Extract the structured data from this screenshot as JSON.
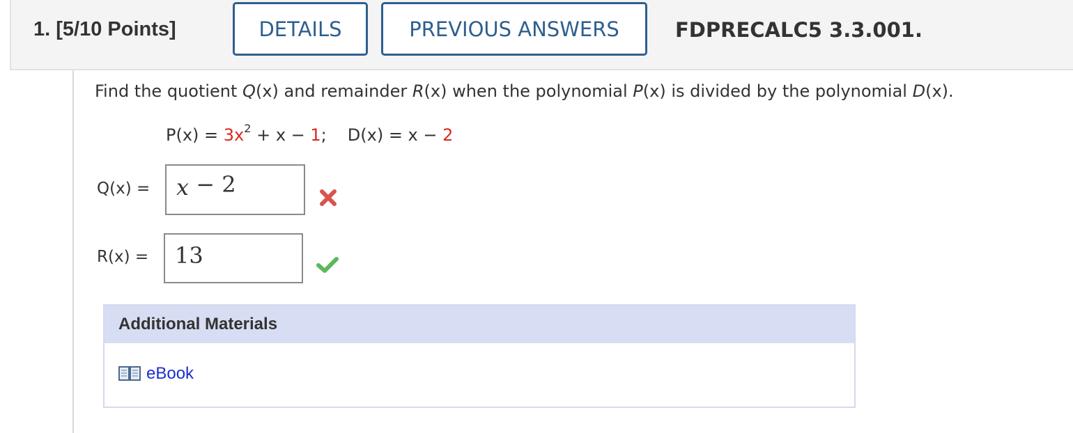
{
  "header": {
    "question_label": "1. [5/10 Points]",
    "details_label": "DETAILS",
    "previous_answers_label": "PREVIOUS ANSWERS",
    "question_id": "FDPRECALC5 3.3.001."
  },
  "question": {
    "prompt_start": "Find the quotient ",
    "prompt_q": "Q",
    "prompt_mid1": "(x) and remainder ",
    "prompt_r": "R",
    "prompt_mid2": "(x) when the polynomial ",
    "prompt_p": "P",
    "prompt_mid3": "(x) is divided by the polynomial ",
    "prompt_d": "D",
    "prompt_end": "(x).",
    "eq_p_lhs": "P(x)",
    "eq_eq1": " = ",
    "eq_p_coef": "3x",
    "eq_p_exp": "2",
    "eq_p_mid": " + x − ",
    "eq_p_const": "1",
    "eq_sep": ";",
    "eq_d_lhs": "D(x)",
    "eq_eq2": " = x − ",
    "eq_d_const": "2"
  },
  "answers": {
    "q_label": "Q(x) =",
    "q_value_var": "x",
    "q_value_rest": " − 2",
    "q_status": "incorrect",
    "r_label": "R(x) =",
    "r_value": "13",
    "r_status": "correct"
  },
  "additional_materials": {
    "title": "Additional Materials",
    "ebook_label": "eBook",
    "ebook_icon": "book-icon"
  },
  "colors": {
    "accent_blue": "#2e5f8f",
    "highlight_red": "#d62b1f",
    "correct_green": "#5cb85c",
    "incorrect_red": "#d9534f",
    "materials_header": "#d7ddf2",
    "link_blue": "#1c2fd0"
  }
}
